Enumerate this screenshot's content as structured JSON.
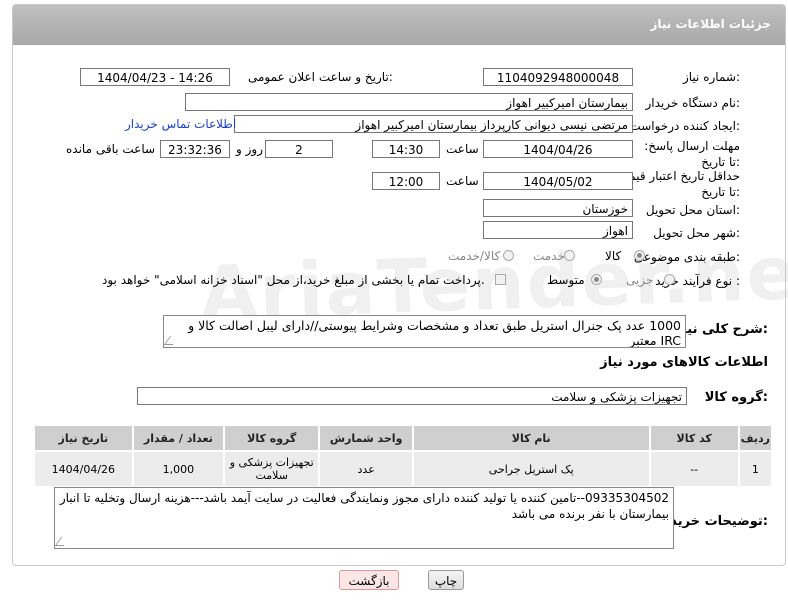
{
  "header": {
    "title": "جزئیات اطلاعات نیاز"
  },
  "need_number": {
    "label": "شماره نیاز:",
    "value": "1104092948000048"
  },
  "announce": {
    "label": "تاریخ و ساعت اعلان عمومی:",
    "value": "1404/04/23 - 14:26"
  },
  "buyer_org": {
    "label": "نام دستگاه خریدار:",
    "value": "بیمارستان امیرکبیر اهواز"
  },
  "requester": {
    "label": "ایجاد کننده درخواست:",
    "value": "مرتضی نیسی دیوانی کارپرداز بیمارستان امیرکبیر اهواز",
    "contact_link": "اطلاعات تماس خریدار"
  },
  "deadline": {
    "label": "مهلت ارسال پاسخ: تا تاریخ:",
    "date": "1404/04/26",
    "time_label": "ساعت",
    "time": "14:30",
    "days": "2",
    "days_label": "روز و",
    "remaining": "23:32:36",
    "remaining_label": "ساعت باقی مانده"
  },
  "price_validity": {
    "label": "حداقل تاریخ اعتبار قیمت: تا تاریخ:",
    "date": "1404/05/02",
    "time_label": "ساعت",
    "time": "12:00"
  },
  "province": {
    "label": "استان محل تحویل:",
    "value": "خوزستان"
  },
  "city": {
    "label": "شهر محل تحویل:",
    "value": "اهواز"
  },
  "category": {
    "label": "طبقه بندی موضوعی:",
    "options": [
      "کالا",
      "خدمت",
      "کالا/خدمت"
    ]
  },
  "purchase_type": {
    "label": "نوع فرآیند خرید :",
    "options": [
      "جزیی",
      "متوسط"
    ],
    "payment_note": "پرداخت تمام یا بخشی از مبلغ خرید،از محل \"اسناد خزانه اسلامی\" خواهد بود."
  },
  "description": {
    "label": "شرح کلی نیاز:",
    "value": "1000 عدد پک جنرال استریل طبق  تعداد و مشخصات وشرایط پیوستی//دارای لیبل اصالت کالا و IRC معتبر"
  },
  "items_section": {
    "title": "اطلاعات کالاهای مورد نیاز"
  },
  "goods_group": {
    "label": "گروه کالا:",
    "value": "تجهیزات پزشکی و سلامت"
  },
  "table": {
    "headers": [
      "ردیف",
      "کد کالا",
      "نام کالا",
      "واحد شمارش",
      "گروه کالا",
      "تعداد / مقدار",
      "تاریخ نیاز"
    ],
    "rows": [
      [
        "1",
        "--",
        "پک استریل جراحی",
        "عدد",
        "تجهیزات پزشکی و سلامت",
        "1,000",
        "1404/04/26"
      ]
    ]
  },
  "buyer_notes": {
    "label": "توضیحات خریدار:",
    "value": "09335304502--تامین کننده یا تولید کننده دارای  مجوز ونمایندگی فعالیت در سایت آیمد باشد---هزینه ارسال وتخلیه تا انبار بیمارستان با نفر برنده می باشد"
  },
  "buttons": {
    "print": "چاپ",
    "back": "بازگشت"
  },
  "watermark": "AriaTender.net"
}
